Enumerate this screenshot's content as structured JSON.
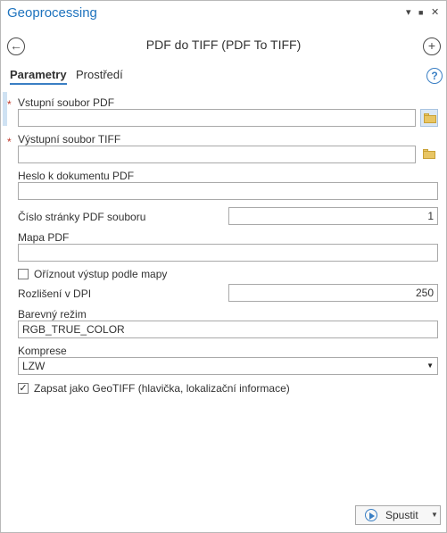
{
  "window": {
    "title": "Geoprocessing",
    "pin_glyph": "▾",
    "pin2_glyph": "■",
    "close_glyph": "✕"
  },
  "tool": {
    "title": "PDF do TIFF (PDF To TIFF)",
    "back_glyph": "←",
    "add_glyph": "+"
  },
  "tabs": [
    {
      "label": "Parametry"
    },
    {
      "label": "Prostředí"
    }
  ],
  "help_glyph": "?",
  "required_mark": "*",
  "params": {
    "input_pdf": {
      "label": "Vstupní soubor PDF",
      "value": ""
    },
    "output_tiff": {
      "label": "Výstupní soubor TIFF",
      "value": ""
    },
    "pdf_password": {
      "label": "Heslo k dokumentu PDF",
      "value": ""
    },
    "page_number": {
      "label": "Číslo stránky PDF souboru",
      "value": "1"
    },
    "pdf_map": {
      "label": "Mapa PDF",
      "value": ""
    },
    "clip_to_map": {
      "label": "Oříznout výstup podle mapy",
      "checked": false,
      "mark": ""
    },
    "resolution": {
      "label": "Rozlišení v DPI",
      "value": "250"
    },
    "color_mode": {
      "label": "Barevný režim",
      "value": "RGB_TRUE_COLOR"
    },
    "compression": {
      "label": "Komprese",
      "value": "LZW",
      "arrow": "▼"
    },
    "geotiff": {
      "label": "Zapsat jako GeoTIFF (hlavička, lokalizační informace)",
      "checked": true,
      "mark": "✓"
    }
  },
  "run": {
    "label": "Spustit",
    "caret": "▼"
  }
}
